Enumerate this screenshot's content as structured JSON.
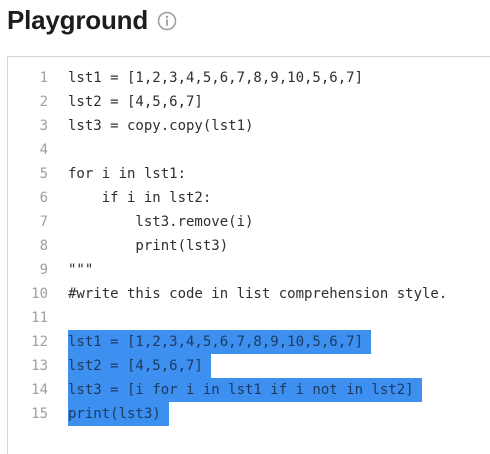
{
  "header": {
    "title": "Playground",
    "info_icon": "info-circle-icon"
  },
  "editor": {
    "lines": [
      {
        "num": "1",
        "text": "lst1 = [1,2,3,4,5,6,7,8,9,10,5,6,7]",
        "selected": false
      },
      {
        "num": "2",
        "text": "lst2 = [4,5,6,7]",
        "selected": false
      },
      {
        "num": "3",
        "text": "lst3 = copy.copy(lst1)",
        "selected": false
      },
      {
        "num": "4",
        "text": "",
        "selected": false
      },
      {
        "num": "5",
        "text": "for i in lst1:",
        "selected": false
      },
      {
        "num": "6",
        "text": "    if i in lst2:",
        "selected": false
      },
      {
        "num": "7",
        "text": "        lst3.remove(i)",
        "selected": false
      },
      {
        "num": "8",
        "text": "        print(lst3)",
        "selected": false
      },
      {
        "num": "9",
        "text": "\"\"\"",
        "selected": false
      },
      {
        "num": "10",
        "text": "#write this code in list comprehension style.",
        "selected": false
      },
      {
        "num": "11",
        "text": "",
        "selected": false
      },
      {
        "num": "12",
        "text": "lst1 = [1,2,3,4,5,6,7,8,9,10,5,6,7]",
        "selected": true
      },
      {
        "num": "13",
        "text": "lst2 = [4,5,6,7]",
        "selected": true
      },
      {
        "num": "14",
        "text": "lst3 = [i for i in lst1 if i not in lst2]",
        "selected": true
      },
      {
        "num": "15",
        "text": "print(lst3)",
        "selected": true
      }
    ],
    "selection_color": "#3d8ff0"
  }
}
